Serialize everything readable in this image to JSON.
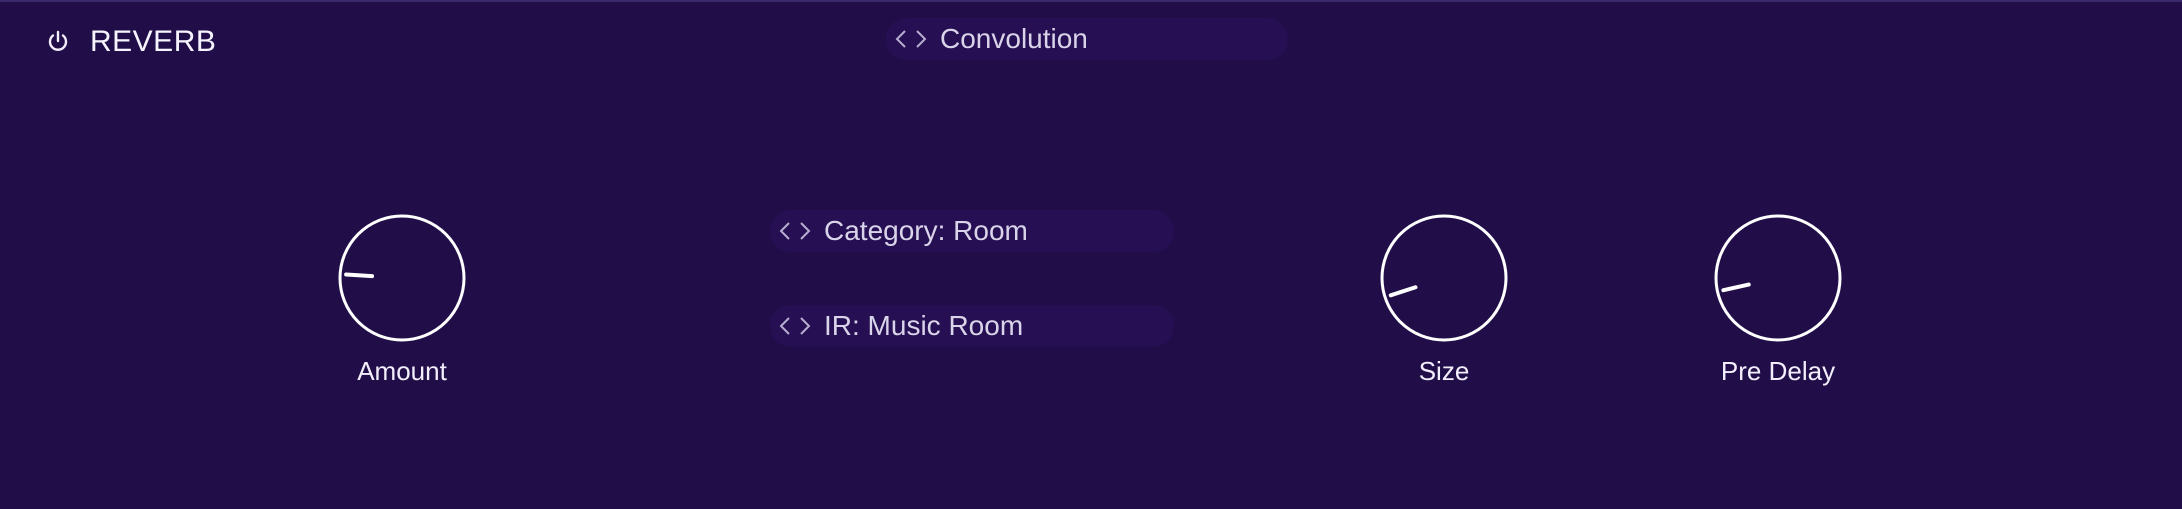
{
  "module": {
    "title": "REVERB",
    "power_icon": "power-icon",
    "enabled": true
  },
  "selectors": {
    "algorithm": {
      "label": "Convolution"
    },
    "category": {
      "label": "Category: Room"
    },
    "ir": {
      "label": "IR: Music Room"
    }
  },
  "knobs": {
    "amount": {
      "label": "Amount",
      "value": 0.18
    },
    "size": {
      "label": "Size",
      "value": 0.1
    },
    "predelay": {
      "label": "Pre Delay",
      "value": 0.12
    }
  },
  "colors": {
    "background": "#210e49",
    "pill": "#260f52",
    "knob_stroke": "#ffffff",
    "text": "#f2eefc"
  },
  "icons": {
    "prev": "chevron-left-icon",
    "next": "chevron-right-icon"
  }
}
